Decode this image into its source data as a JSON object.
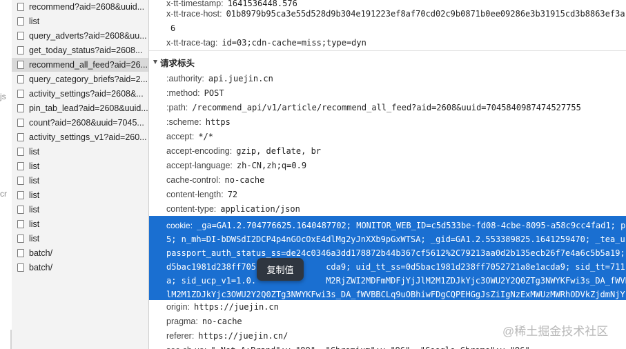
{
  "left_fragments": [
    "js",
    "cr"
  ],
  "file_list": [
    {
      "name": "recommend?aid=2608&uuid..."
    },
    {
      "name": "list"
    },
    {
      "name": "query_adverts?aid=2608&uu..."
    },
    {
      "name": "get_today_status?aid=2608..."
    },
    {
      "name": "recommend_all_feed?aid=26...",
      "selected": true
    },
    {
      "name": "query_category_briefs?aid=2..."
    },
    {
      "name": "activity_settings?aid=2608&..."
    },
    {
      "name": "pin_tab_lead?aid=2608&uuid..."
    },
    {
      "name": "count?aid=2608&uuid=7045..."
    },
    {
      "name": "activity_settings_v1?aid=260..."
    },
    {
      "name": "list"
    },
    {
      "name": "list"
    },
    {
      "name": "list"
    },
    {
      "name": "list"
    },
    {
      "name": "list"
    },
    {
      "name": "list"
    },
    {
      "name": "list"
    },
    {
      "name": "batch/"
    },
    {
      "name": "batch/"
    }
  ],
  "response_headers_tail": [
    {
      "name": "x-tt-timestamp:",
      "value": "1641536448.576"
    },
    {
      "name": "x-tt-trace-host:",
      "value": "01b8979b95ca3e55d528d9b304e191223ef8af70cd02c9b0871b0ee09286e3b31915cd3b8863ef3a"
    },
    {
      "name": "",
      "value": "6"
    },
    {
      "name": "x-tt-trace-tag:",
      "value": "id=03;cdn-cache=miss;type=dyn"
    }
  ],
  "request_section_title": "请求标头",
  "request_headers": [
    {
      "name": ":authority:",
      "value": "api.juejin.cn"
    },
    {
      "name": ":method:",
      "value": "POST"
    },
    {
      "name": ":path:",
      "value": "/recommend_api/v1/article/recommend_all_feed?aid=2608&uuid=7045840987474527755"
    },
    {
      "name": ":scheme:",
      "value": "https"
    },
    {
      "name": "accept:",
      "value": "*/*"
    },
    {
      "name": "accept-encoding:",
      "value": "gzip, deflate, br"
    },
    {
      "name": "accept-language:",
      "value": "zh-CN,zh;q=0.9"
    },
    {
      "name": "cache-control:",
      "value": "no-cache"
    },
    {
      "name": "content-length:",
      "value": "72"
    },
    {
      "name": "content-type:",
      "value": "application/json"
    }
  ],
  "cookie": {
    "name": "cookie:",
    "lines": [
      "_ga=GA1.2.704776625.1640487702; MONITOR_WEB_ID=c5d533be-fd08-4cbe-8095-a58c9cc4fad1; p",
      "5; n_mh=DI-bDWSdI2DCP4p4nGOcOxE4dlMg2yJnXXb9pGxWTSA; _gid=GA1.2.553389825.1641259470; _tea_u",
      "passport_auth_status_ss=de24c0346a3dd178872b44b367cf5612%2C79213aa0d2b135ecb26f7e4a6c5b5a19;",
      "d5bac1981d238ff705              cda9; uid_tt_ss=0d5bac1981d238ff7052721a8e1acda9; sid_tt=7111e31d",
      "a; sid_ucp_v1=1.0.              M2RjZWI2MDFmMDFjYjJlM2M1ZDJkYjc3OWU2Y2Q0ZTg3NWYKFwi3s_DA_fWVBBCL",
      "lM2M1ZDJkYjc3OWU2Y2Q0ZTg3NWYKFwi3s_DA_fWVBBCLq9uOBhiwFDgCQPEHGgJsZiIgNzExMWUzMWRhODVkZjdmNjY"
    ]
  },
  "request_headers_after": [
    {
      "name": "origin:",
      "value": "https://juejin.cn"
    },
    {
      "name": "pragma:",
      "value": "no-cache"
    },
    {
      "name": "referer:",
      "value": "https://juejin.cn/"
    },
    {
      "name": "sec-ch-ua:",
      "value": "\" Not A;Brand\";v=\"99\", \"Chromium\";v=\"96\", \"Google Chrome\";v=\"96\""
    }
  ],
  "tooltip": "复制值",
  "watermark": "@稀土掘金技术社区"
}
